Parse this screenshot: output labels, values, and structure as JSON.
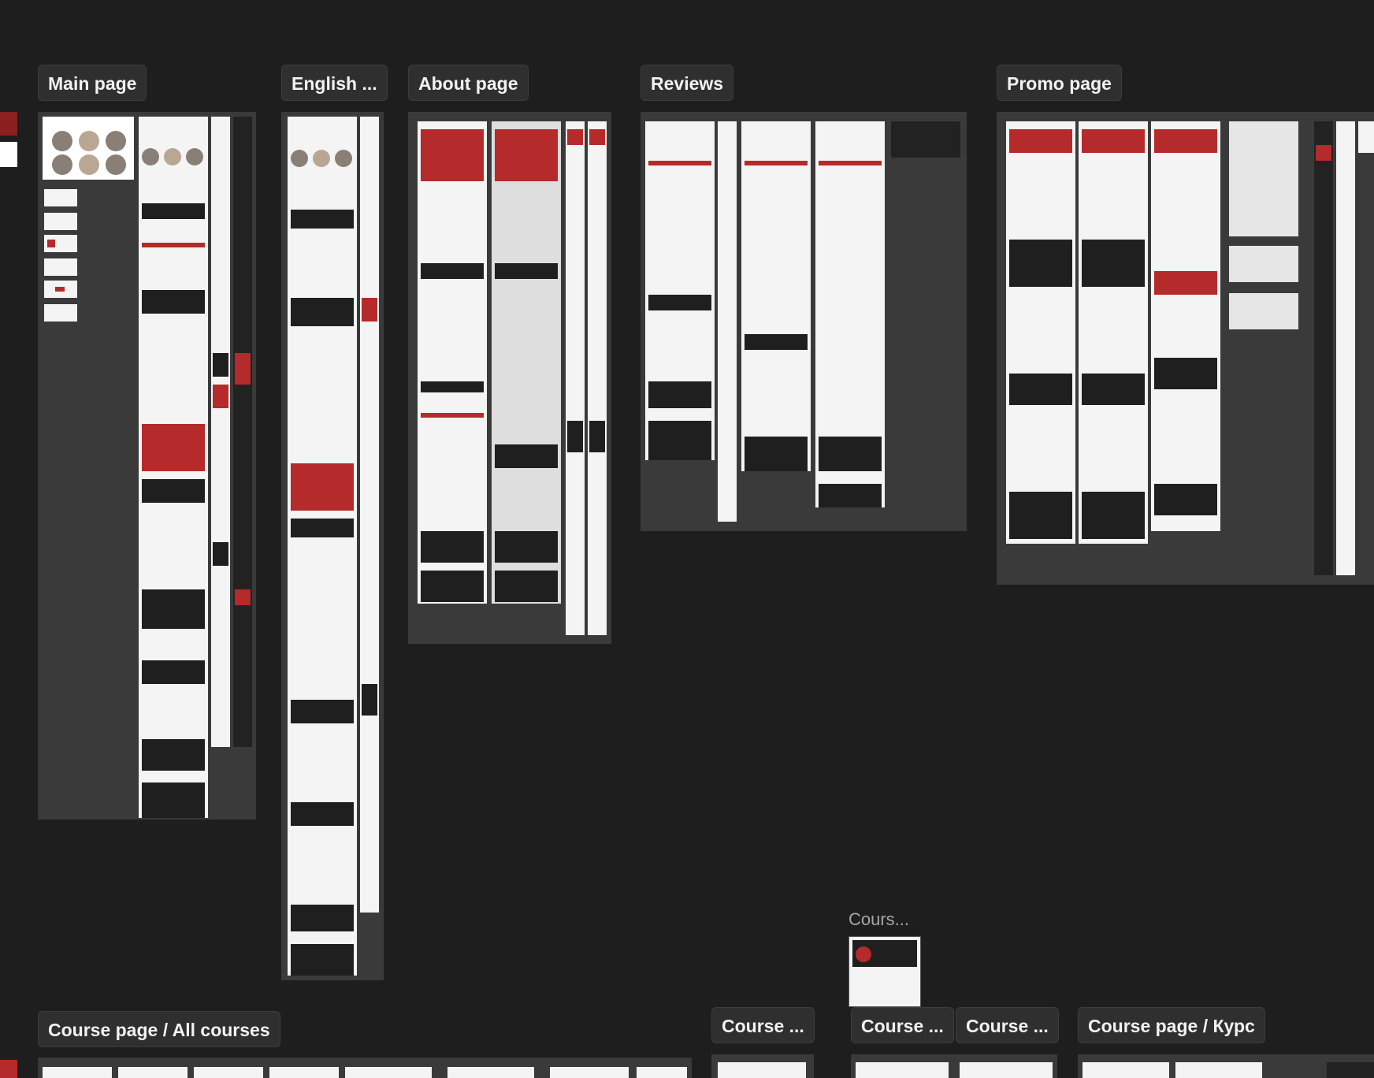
{
  "canvas": {
    "background": "#1e1e1e",
    "accent": "#b52a2a"
  },
  "labels": {
    "main_page": "Main page",
    "english": "English ...",
    "about_page": "About page",
    "reviews": "Reviews",
    "promo_page": "Promo page",
    "course_all": "Course page / All courses",
    "course_1": "Course ...",
    "course_2": "Course ...",
    "course_3": "Course ...",
    "course_kurs": "Course page / Курс",
    "courses_small": "Cours..."
  }
}
